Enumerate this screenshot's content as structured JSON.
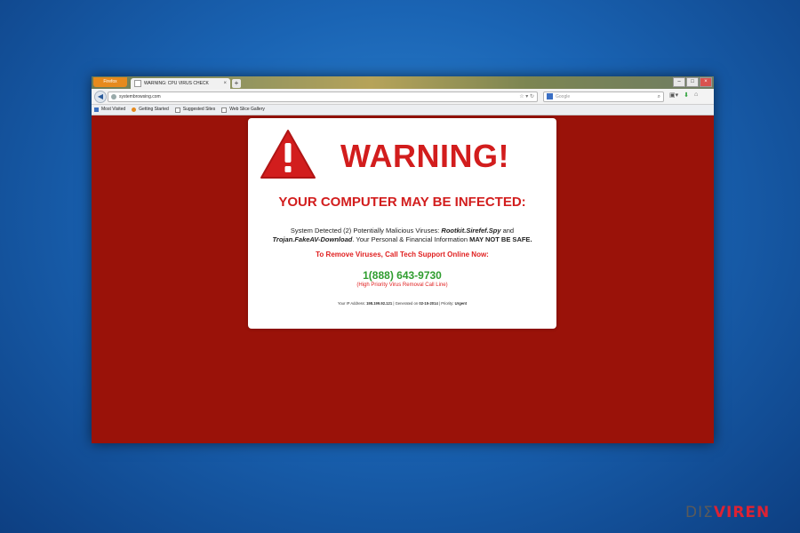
{
  "browser": {
    "app_button": "Firefox",
    "tab": {
      "title": "WARNING: CPU VIRUS CHECK",
      "close": "×"
    },
    "new_tab": "+",
    "window_buttons": {
      "minimize": "–",
      "maximize": "□",
      "close": "×"
    },
    "address": "systembrowsing.com",
    "search_placeholder": "Google",
    "bookmarks": [
      "Most Visited",
      "Getting Started",
      "Suggested Sites",
      "Web Slice Gallery"
    ]
  },
  "warning": {
    "heading": "WARNING!",
    "subheading": "YOUR COMPUTER MAY BE INFECTED:",
    "detected_prefix": "System Detected (2) Potentially Malicious Viruses: ",
    "virus1": "Rootkit.Sirefef.Spy",
    "detected_and": " and ",
    "virus2": "Trojan.FakeAV-Download",
    "detected_mid": ". Your Personal & Financial Information ",
    "detected_bold": "MAY NOT BE SAFE.",
    "cta": "To Remove Viruses, Call Tech Support Online Now:",
    "phone": "1(888) 643-9730",
    "phone_note": "(High Priority Virus Removal Call Line)",
    "footer_ip_label": "Your IP Address: ",
    "footer_ip": "198.199.92.121",
    "footer_gen_label": " | Generated on ",
    "footer_date": "02-15-2014",
    "footer_priority_label": " | Priority: ",
    "footer_priority": "Urgent"
  },
  "watermark": {
    "left": "DI",
    "mark": "Σ",
    "right": "VIREN"
  },
  "colors": {
    "page_background": "#9a1209",
    "warning_red": "#d21d1d",
    "phone_green": "#2f9d2f",
    "desktop_blue": "#1a64b4"
  }
}
